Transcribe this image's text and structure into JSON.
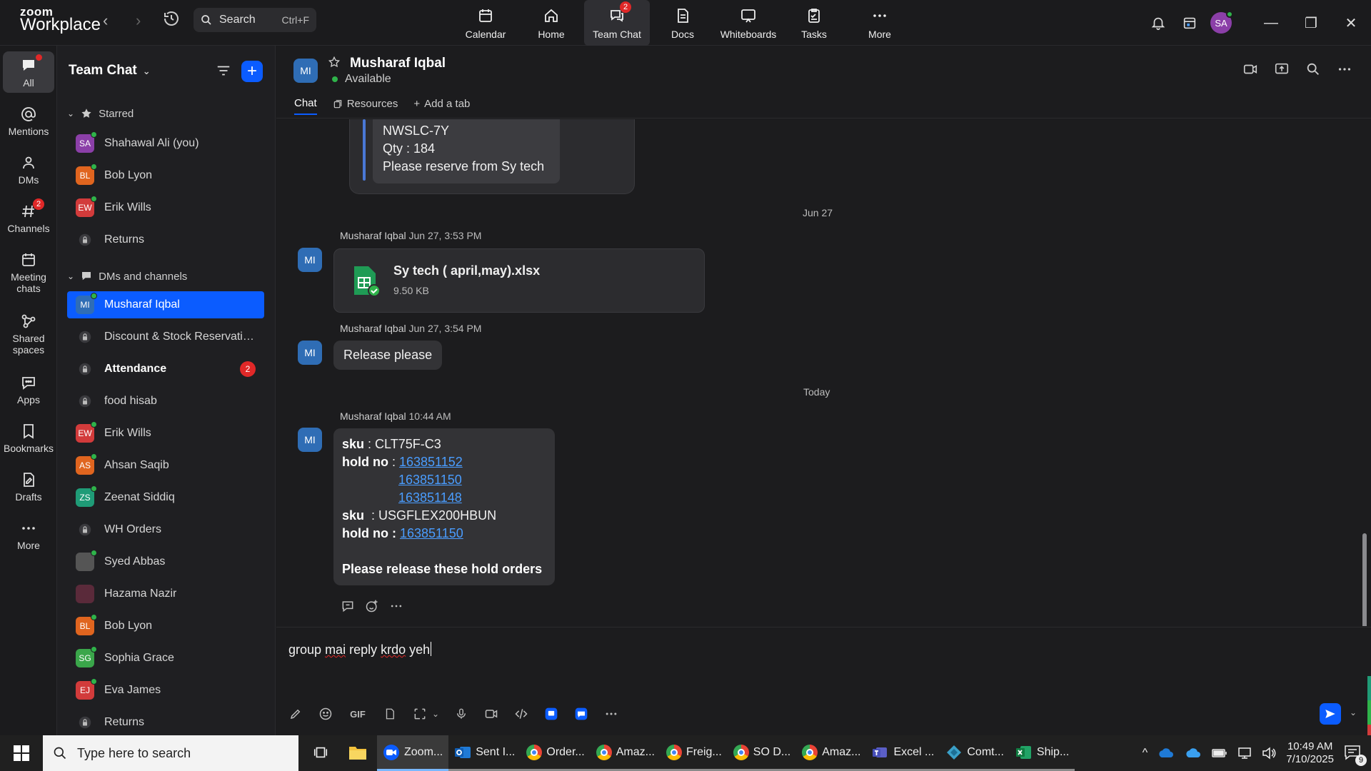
{
  "app": {
    "logo_top": "zoom",
    "logo_bottom": "Workplace",
    "search_label": "Search",
    "search_shortcut": "Ctrl+F",
    "nav": [
      {
        "label": "Calendar",
        "icon": "calendar-icon"
      },
      {
        "label": "Home",
        "icon": "home-icon"
      },
      {
        "label": "Team Chat",
        "icon": "team-chat-icon",
        "badge": "2",
        "active": true
      },
      {
        "label": "Docs",
        "icon": "docs-icon"
      },
      {
        "label": "Whiteboards",
        "icon": "whiteboard-icon"
      },
      {
        "label": "Tasks",
        "icon": "tasks-icon"
      },
      {
        "label": "More",
        "icon": "more-icon"
      }
    ],
    "user_initials": "SA"
  },
  "rail": [
    {
      "label": "All",
      "active": true
    },
    {
      "label": "Mentions"
    },
    {
      "label": "DMs"
    },
    {
      "label": "Channels",
      "badge": "2"
    },
    {
      "label": "Meeting chats"
    },
    {
      "label": "Shared spaces"
    },
    {
      "label": "Apps"
    },
    {
      "label": "Bookmarks"
    },
    {
      "label": "Drafts"
    },
    {
      "label": "More"
    }
  ],
  "sidebar": {
    "title": "Team Chat",
    "starred_label": "Starred",
    "dms_label": "DMs and channels",
    "starred": [
      {
        "initials": "SA",
        "name": "Shahawal Ali (you)",
        "color": "#8b3fa8",
        "online": true
      },
      {
        "initials": "BL",
        "name": "Bob Lyon",
        "color": "#e0651f",
        "online": true
      },
      {
        "initials": "EW",
        "name": "Erik Wills",
        "color": "#d23b3b",
        "online": true
      },
      {
        "lock": true,
        "name": "Returns"
      }
    ],
    "dms": [
      {
        "initials": "MI",
        "name": "Musharaf Iqbal",
        "color": "#2f6db5",
        "online": true,
        "active": true
      },
      {
        "lock": true,
        "name": "Discount & Stock Reservatio..."
      },
      {
        "lock": true,
        "name": "Attendance",
        "bold": true,
        "count": "2"
      },
      {
        "lock": true,
        "name": "food hisab"
      },
      {
        "initials": "EW",
        "name": "Erik Wills",
        "color": "#d23b3b",
        "online": true
      },
      {
        "initials": "AS",
        "name": "Ahsan Saqib",
        "color": "#e0651f",
        "online": true
      },
      {
        "initials": "ZS",
        "name": "Zeenat Siddiq",
        "color": "#1f9b77",
        "online": true
      },
      {
        "lock": true,
        "name": "WH Orders"
      },
      {
        "initials": "",
        "name": "Syed Abbas",
        "color": "#555555",
        "online": true,
        "photo": true
      },
      {
        "initials": "",
        "name": "Hazama Nazir",
        "color": "#5a2a3a",
        "online": false,
        "photo": true
      },
      {
        "initials": "BL",
        "name": "Bob Lyon",
        "color": "#e0651f",
        "online": true
      },
      {
        "initials": "SG",
        "name": "Sophia Grace",
        "color": "#3aa64a",
        "online": true
      },
      {
        "initials": "EJ",
        "name": "Eva James",
        "color": "#d23b3b",
        "online": true
      },
      {
        "lock": true,
        "name": "Returns"
      }
    ]
  },
  "chat": {
    "contact_initials": "MI",
    "contact_name": "Musharaf Iqbal",
    "status": "Available",
    "tabs": [
      "Chat",
      "Resources",
      "Add a tab"
    ],
    "quote_lines": [
      "NWSLC-7Y",
      "Qty : 184",
      "Please reserve from Sy tech"
    ],
    "date_jun27": "Jun 27",
    "date_today": "Today",
    "msg1_sender": "Musharaf Iqbal",
    "msg1_time": "Jun 27, 3:53 PM",
    "file_name": "Sy tech ( april,may).xlsx",
    "file_size": "9.50 KB",
    "msg2_sender": "Musharaf Iqbal",
    "msg2_time": "Jun 27, 3:54 PM",
    "msg2_text": "Release please",
    "msg3_sender": "Musharaf Iqbal",
    "msg3_time": "10:44 AM",
    "msg3": {
      "sku_label": "sku",
      "sku1": " : CLT75F-C3",
      "hold_label": "hold no",
      "holds1": [
        "163851152",
        "163851150",
        "163851148"
      ],
      "sku2": "  : USGFLEX200HBUN",
      "holds2": [
        "163851150"
      ],
      "footer": "Please release these hold orders"
    },
    "composer_words": [
      "group",
      "mai",
      "reply",
      "krdo",
      "yeh"
    ]
  },
  "taskbar": {
    "search_placeholder": "Type here to search",
    "apps": [
      "Zoom...",
      "Sent I...",
      "Order...",
      "Amaz...",
      "Freig...",
      "SO D...",
      "Amaz...",
      "Excel ...",
      "Comt...",
      "Ship..."
    ],
    "time": "10:49 AM",
    "date": "7/10/2025",
    "notifications": "9"
  }
}
